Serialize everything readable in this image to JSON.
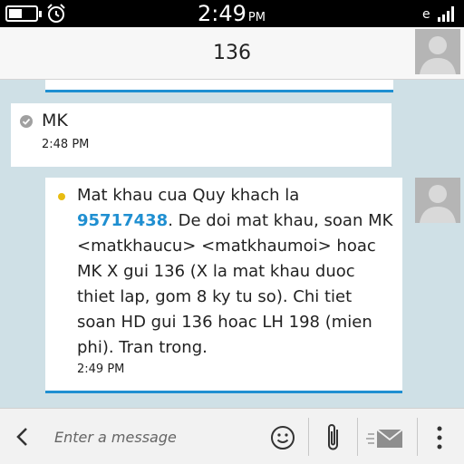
{
  "status_bar": {
    "time": "2:49",
    "ampm": "PM",
    "network": "e",
    "icons": [
      "battery-icon",
      "alarm-icon",
      "signal-icon"
    ]
  },
  "header": {
    "contact_name": "136",
    "avatar_icon": "avatar-icon"
  },
  "messages": [
    {
      "direction": "outgoing",
      "status_icon": "sent-check-icon",
      "text": "MK",
      "time": "2:48 PM"
    },
    {
      "direction": "incoming",
      "unread_indicator": "unread-dot",
      "text_before_link": "Mat khau cua Quy khach la ",
      "link": "95717438",
      "text_after_link": ". De doi mat khau, soan MK <matkhaucu> <matkhaumoi> hoac MK X gui 136 (X la mat khau duoc thiet lap, gom 8 ky tu so). Chi tiet soan HD gui 136 hoac LH 198 (mien phi). Tran trong.",
      "time": "2:49 PM"
    }
  ],
  "composer": {
    "placeholder": "Enter a message",
    "icons": [
      "back-icon",
      "emoji-icon",
      "attach-icon",
      "send-icon",
      "menu-icon"
    ]
  },
  "colors": {
    "background": "#cfe0e6",
    "accent": "#1f8fd1",
    "unread": "#e8bc12",
    "status_bar": "#000000"
  }
}
